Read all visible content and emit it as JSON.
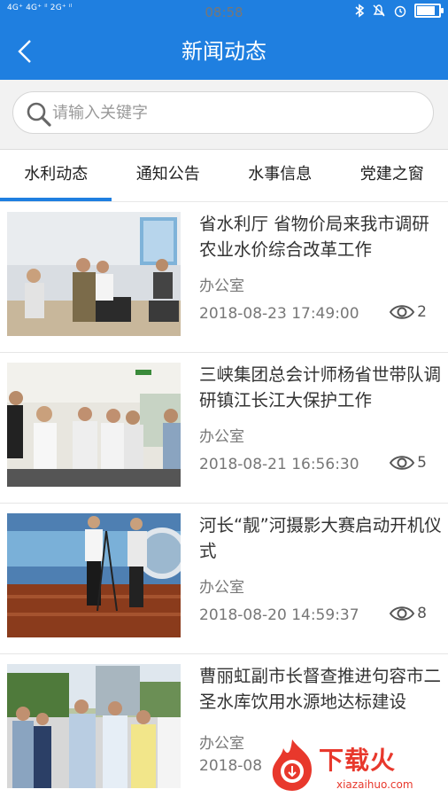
{
  "status_bar": {
    "network_left": "4G⁺ 4G⁺ ⁱˡ 2G⁺ ⁱˡ",
    "time": "08:58",
    "icons": [
      "bluetooth-icon",
      "mute-icon",
      "alarm-icon",
      "battery-icon"
    ],
    "battery_level": 0.9
  },
  "header": {
    "title": "新闻动态",
    "background": "#1f7fe0"
  },
  "search": {
    "placeholder": "请输入关键字"
  },
  "tabs": [
    {
      "label": "水利动态",
      "active": true
    },
    {
      "label": "通知公告",
      "active": false
    },
    {
      "label": "水事信息",
      "active": false
    },
    {
      "label": "党建之窗",
      "active": false
    }
  ],
  "news": [
    {
      "title": "省水利厅 省物价局来我市调研农业水价综合改革工作",
      "source": "办公室",
      "time": "2018-08-23 17:49:00",
      "views": "2"
    },
    {
      "title": "三峡集团总会计师杨省世带队调研镇江长江大保护工作",
      "source": "办公室",
      "time": "2018-08-21 16:56:30",
      "views": "5"
    },
    {
      "title": "河长“靓”河摄影大赛启动开机仪式",
      "source": "办公室",
      "time": "2018-08-20 14:59:37",
      "views": "8"
    },
    {
      "title": "曹丽虹副市长督查推进句容市二圣水库饮用水源地达标建设",
      "source": "办公室",
      "time": "2018-08",
      "views": ""
    }
  ],
  "watermark": {
    "brand": "下载火",
    "site": "xiazaihuo.com"
  },
  "colors": {
    "accent": "#1f7fe0",
    "watermark": "#e8382c"
  }
}
